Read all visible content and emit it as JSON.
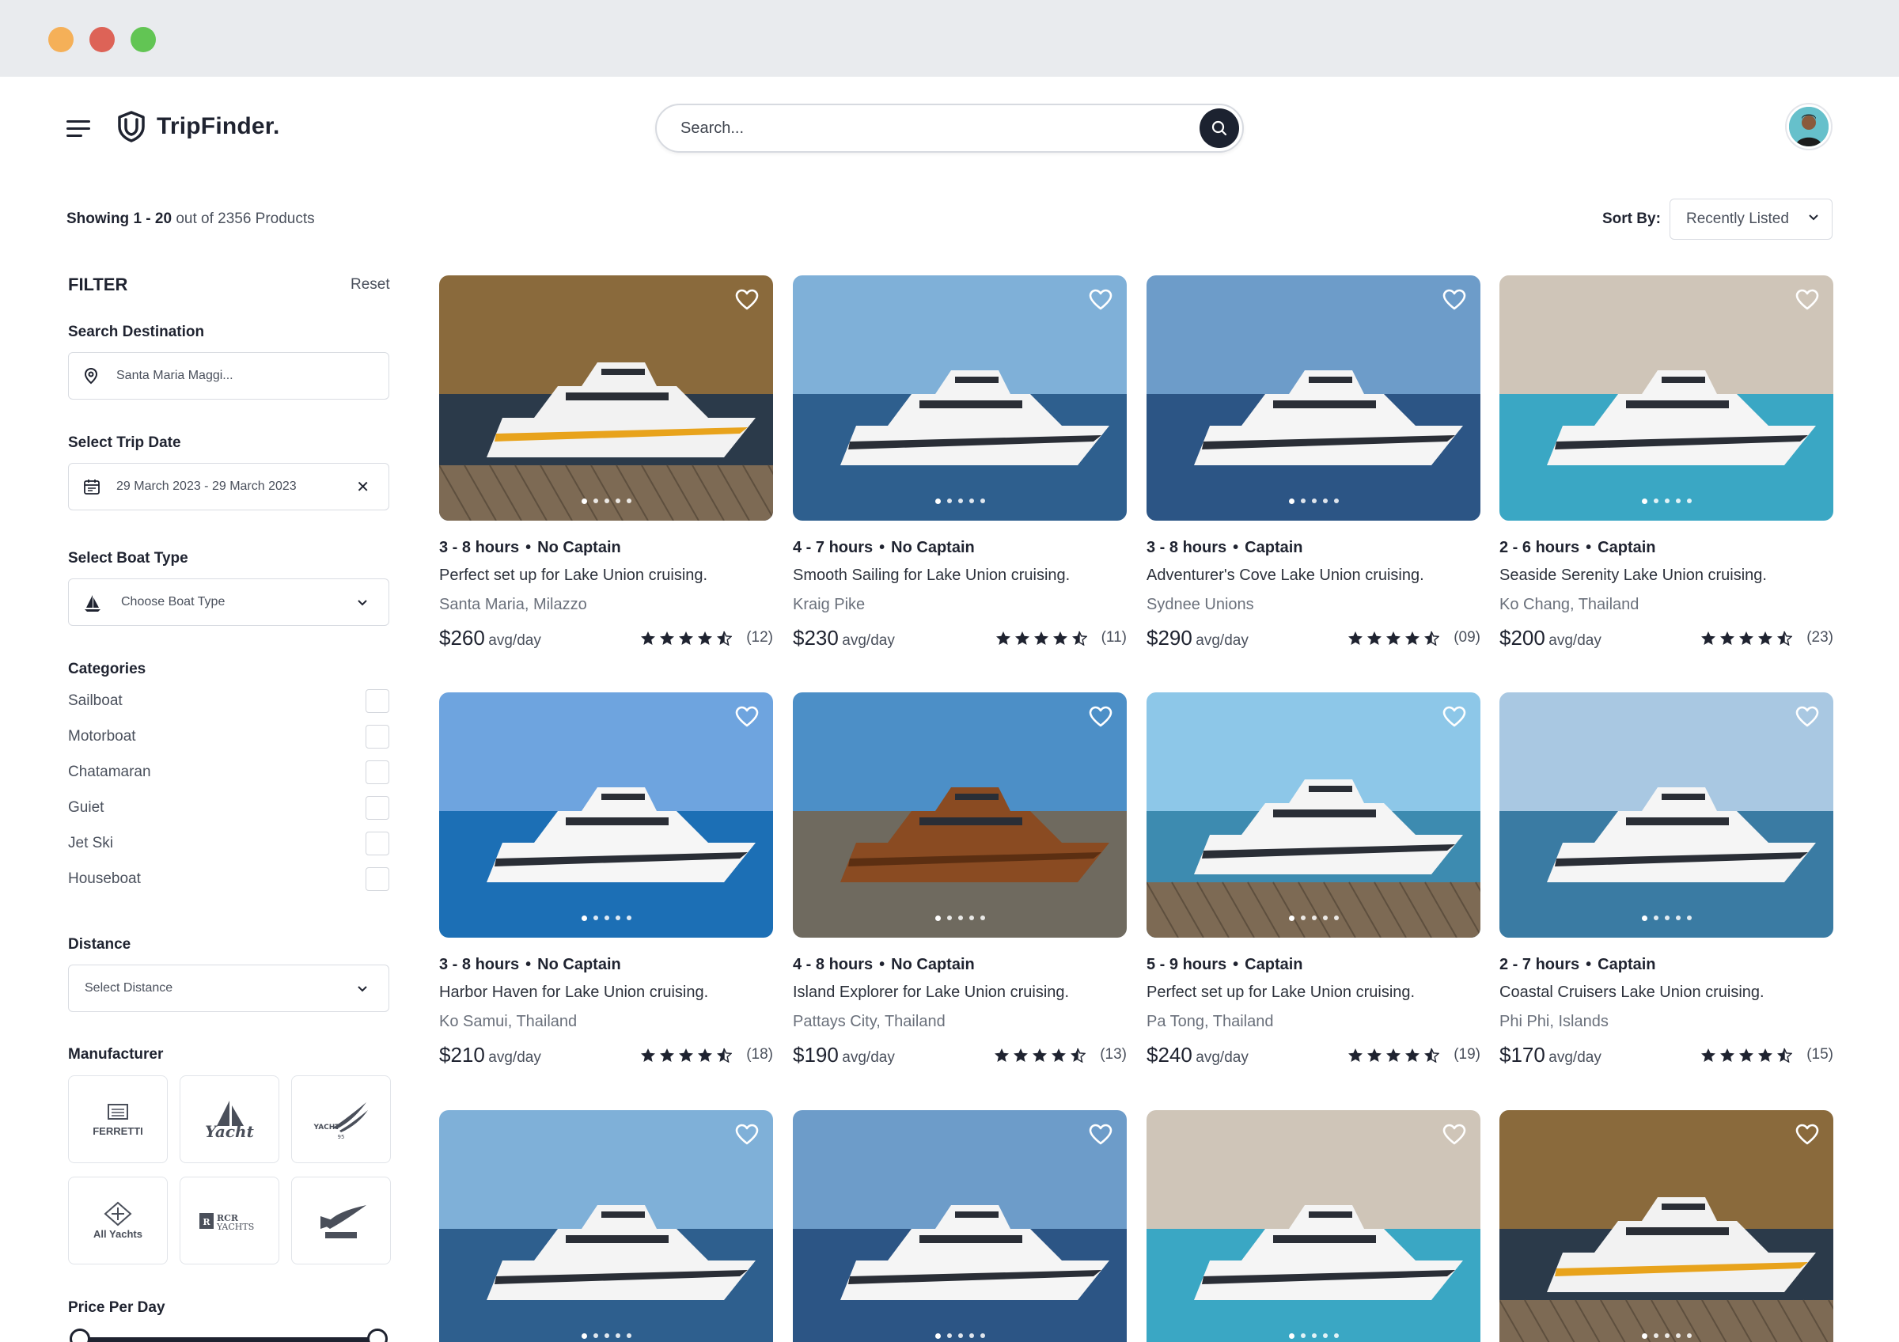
{
  "window": {
    "controls": [
      "minimize",
      "close",
      "maximize"
    ]
  },
  "header": {
    "brand": "TripFinder.",
    "search_placeholder": "Search..."
  },
  "results": {
    "showing_prefix": "Showing",
    "range": "1 - 20",
    "suffix": "out of 2356 Products"
  },
  "sort": {
    "label": "Sort By:",
    "value": "Recently Listed"
  },
  "filter": {
    "title": "FILTER",
    "reset": "Reset",
    "destination_label": "Search Destination",
    "destination_value": "Santa Maria Maggi...",
    "date_label": "Select Trip Date",
    "date_value": "29 March 2023 - 29 March 2023",
    "boat_type_label": "Select Boat Type",
    "boat_type_value": "Choose Boat Type",
    "categories_label": "Categories",
    "categories": [
      {
        "label": "Sailboat",
        "checked": false
      },
      {
        "label": "Motorboat",
        "checked": false
      },
      {
        "label": "Chatamaran",
        "checked": false
      },
      {
        "label": "Guiet",
        "checked": false
      },
      {
        "label": "Jet Ski",
        "checked": false
      },
      {
        "label": "Houseboat",
        "checked": false
      }
    ],
    "distance_label": "Distance",
    "distance_value": "Select Distance",
    "manufacturer_label": "Manufacturer",
    "manufacturers": [
      "FERRETTI",
      "Yacht",
      "YACHT 95",
      "All Yachts",
      "RCR YACHTS",
      "SET SAIL"
    ],
    "price_label": "Price Per Day"
  },
  "colors": {
    "primary": "#1c2230",
    "text_muted": "#6a707b",
    "border": "#d9dce2",
    "star": "#1f2330"
  },
  "listings": [
    {
      "hours": "3 - 8 hours",
      "captain": "No Captain",
      "title": "Perfect set up for Lake Union cruising.",
      "location": "Santa Maria, Milazzo",
      "price": "$260",
      "unit": "avg/day",
      "rating": 4.5,
      "reviews": "(12)"
    },
    {
      "hours": "4 - 7 hours",
      "captain": "No Captain",
      "title": "Smooth Sailing for Lake Union cruising.",
      "location": "Kraig Pike",
      "price": "$230",
      "unit": "avg/day",
      "rating": 4.5,
      "reviews": "(11)"
    },
    {
      "hours": "3 - 8 hours",
      "captain": "Captain",
      "title": "Adventurer's Cove Lake Union cruising.",
      "location": "Sydnee Unions",
      "price": "$290",
      "unit": "avg/day",
      "rating": 4.5,
      "reviews": "(09)"
    },
    {
      "hours": "2 - 6 hours",
      "captain": "Captain",
      "title": "Seaside Serenity Lake Union cruising.",
      "location": "Ko Chang, Thailand",
      "price": "$200",
      "unit": "avg/day",
      "rating": 4.5,
      "reviews": "(23)"
    },
    {
      "hours": "3 - 8 hours",
      "captain": "No Captain",
      "title": "Harbor Haven for Lake Union cruising.",
      "location": "Ko Samui, Thailand",
      "price": "$210",
      "unit": "avg/day",
      "rating": 4.5,
      "reviews": "(18)"
    },
    {
      "hours": "4 - 8 hours",
      "captain": "No Captain",
      "title": "Island Explorer for Lake Union cruising.",
      "location": "Pattays City, Thailand",
      "price": "$190",
      "unit": "avg/day",
      "rating": 4.5,
      "reviews": "(13)"
    },
    {
      "hours": "5 - 9 hours",
      "captain": "Captain",
      "title": "Perfect set up for Lake Union cruising.",
      "location": "Pa Tong, Thailand",
      "price": "$240",
      "unit": "avg/day",
      "rating": 4.5,
      "reviews": "(19)"
    },
    {
      "hours": "2 - 7 hours",
      "captain": "Captain",
      "title": "Coastal Cruisers Lake Union cruising.",
      "location": "Phi Phi, Islands",
      "price": "$170",
      "unit": "avg/day",
      "rating": 4.5,
      "reviews": "(15)"
    },
    {
      "hours": "",
      "captain": "",
      "title": "",
      "location": "",
      "price": "",
      "unit": "",
      "rating": null,
      "reviews": ""
    },
    {
      "hours": "",
      "captain": "",
      "title": "",
      "location": "",
      "price": "",
      "unit": "",
      "rating": null,
      "reviews": ""
    },
    {
      "hours": "",
      "captain": "",
      "title": "",
      "location": "",
      "price": "",
      "unit": "",
      "rating": null,
      "reviews": ""
    },
    {
      "hours": "",
      "captain": "",
      "title": "",
      "location": "",
      "price": "",
      "unit": "",
      "rating": null,
      "reviews": ""
    }
  ]
}
